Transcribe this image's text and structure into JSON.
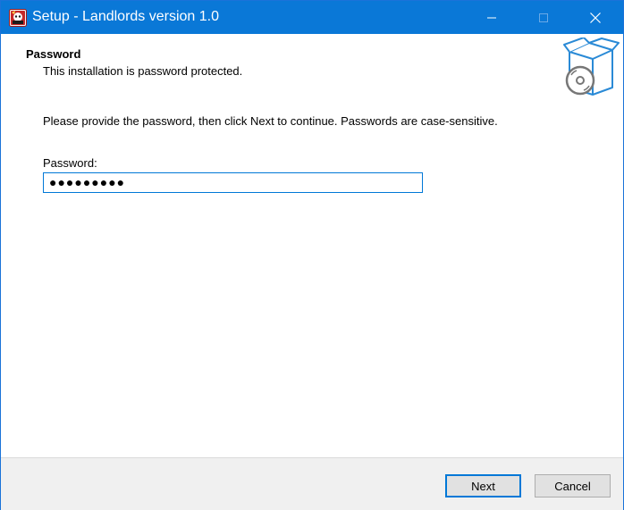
{
  "window": {
    "title": "Setup - Landlords version 1.0",
    "icon": "landlords-app-icon"
  },
  "header": {
    "heading": "Password",
    "subheading": "This installation is password protected.",
    "image_icon": "software-box-cd-icon"
  },
  "content": {
    "instruction": "Please provide the password, then click Next to continue. Passwords are case-sensitive.",
    "password_label": "Password:",
    "password_value_masked": "●●●●●●●●●"
  },
  "footer": {
    "next_label": "Next",
    "cancel_label": "Cancel"
  },
  "colors": {
    "titlebar": "#0a78d7",
    "accent": "#0078d7",
    "footer_bg": "#f0f0f0"
  }
}
